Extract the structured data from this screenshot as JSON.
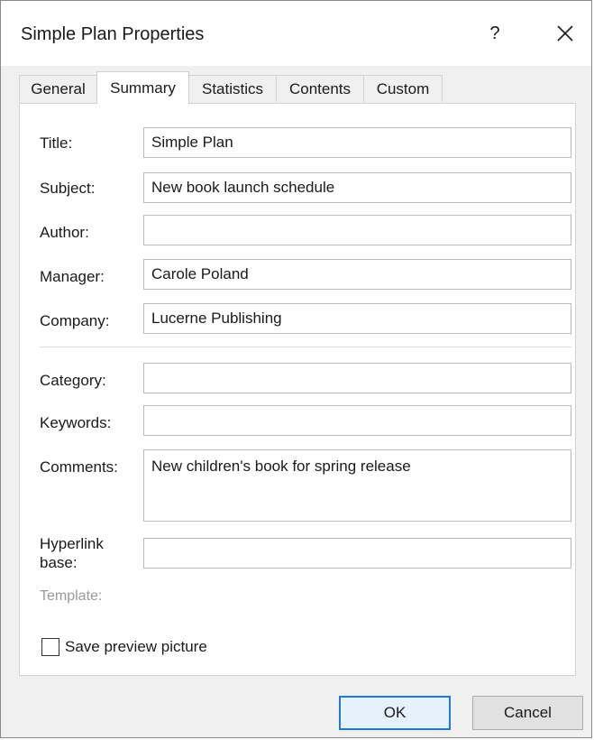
{
  "dialog": {
    "title": "Simple Plan Properties",
    "help_label": "?"
  },
  "tabs": [
    {
      "label": "General",
      "active": false
    },
    {
      "label": "Summary",
      "active": true
    },
    {
      "label": "Statistics",
      "active": false
    },
    {
      "label": "Contents",
      "active": false
    },
    {
      "label": "Custom",
      "active": false
    }
  ],
  "summary": {
    "title_label": "Title:",
    "title_value": "Simple Plan",
    "subject_label": "Subject:",
    "subject_value": "New book launch schedule",
    "author_label": "Author:",
    "author_value": "",
    "manager_label": "Manager:",
    "manager_value": "Carole Poland",
    "company_label": "Company:",
    "company_value": "Lucerne Publishing",
    "category_label": "Category:",
    "category_value": "",
    "keywords_label": "Keywords:",
    "keywords_value": "",
    "comments_label": "Comments:",
    "comments_value": "New children's book for spring release",
    "hyperlink_label_line1": "Hyperlink",
    "hyperlink_label_line2": "base:",
    "hyperlink_value": "",
    "template_label": "Template:",
    "save_preview_label": "Save preview picture",
    "save_preview_checked": false
  },
  "buttons": {
    "ok_label": "OK",
    "cancel_label": "Cancel"
  },
  "colors": {
    "accent": "#1f7ad8",
    "dialog_bg": "#f0f0f0"
  }
}
